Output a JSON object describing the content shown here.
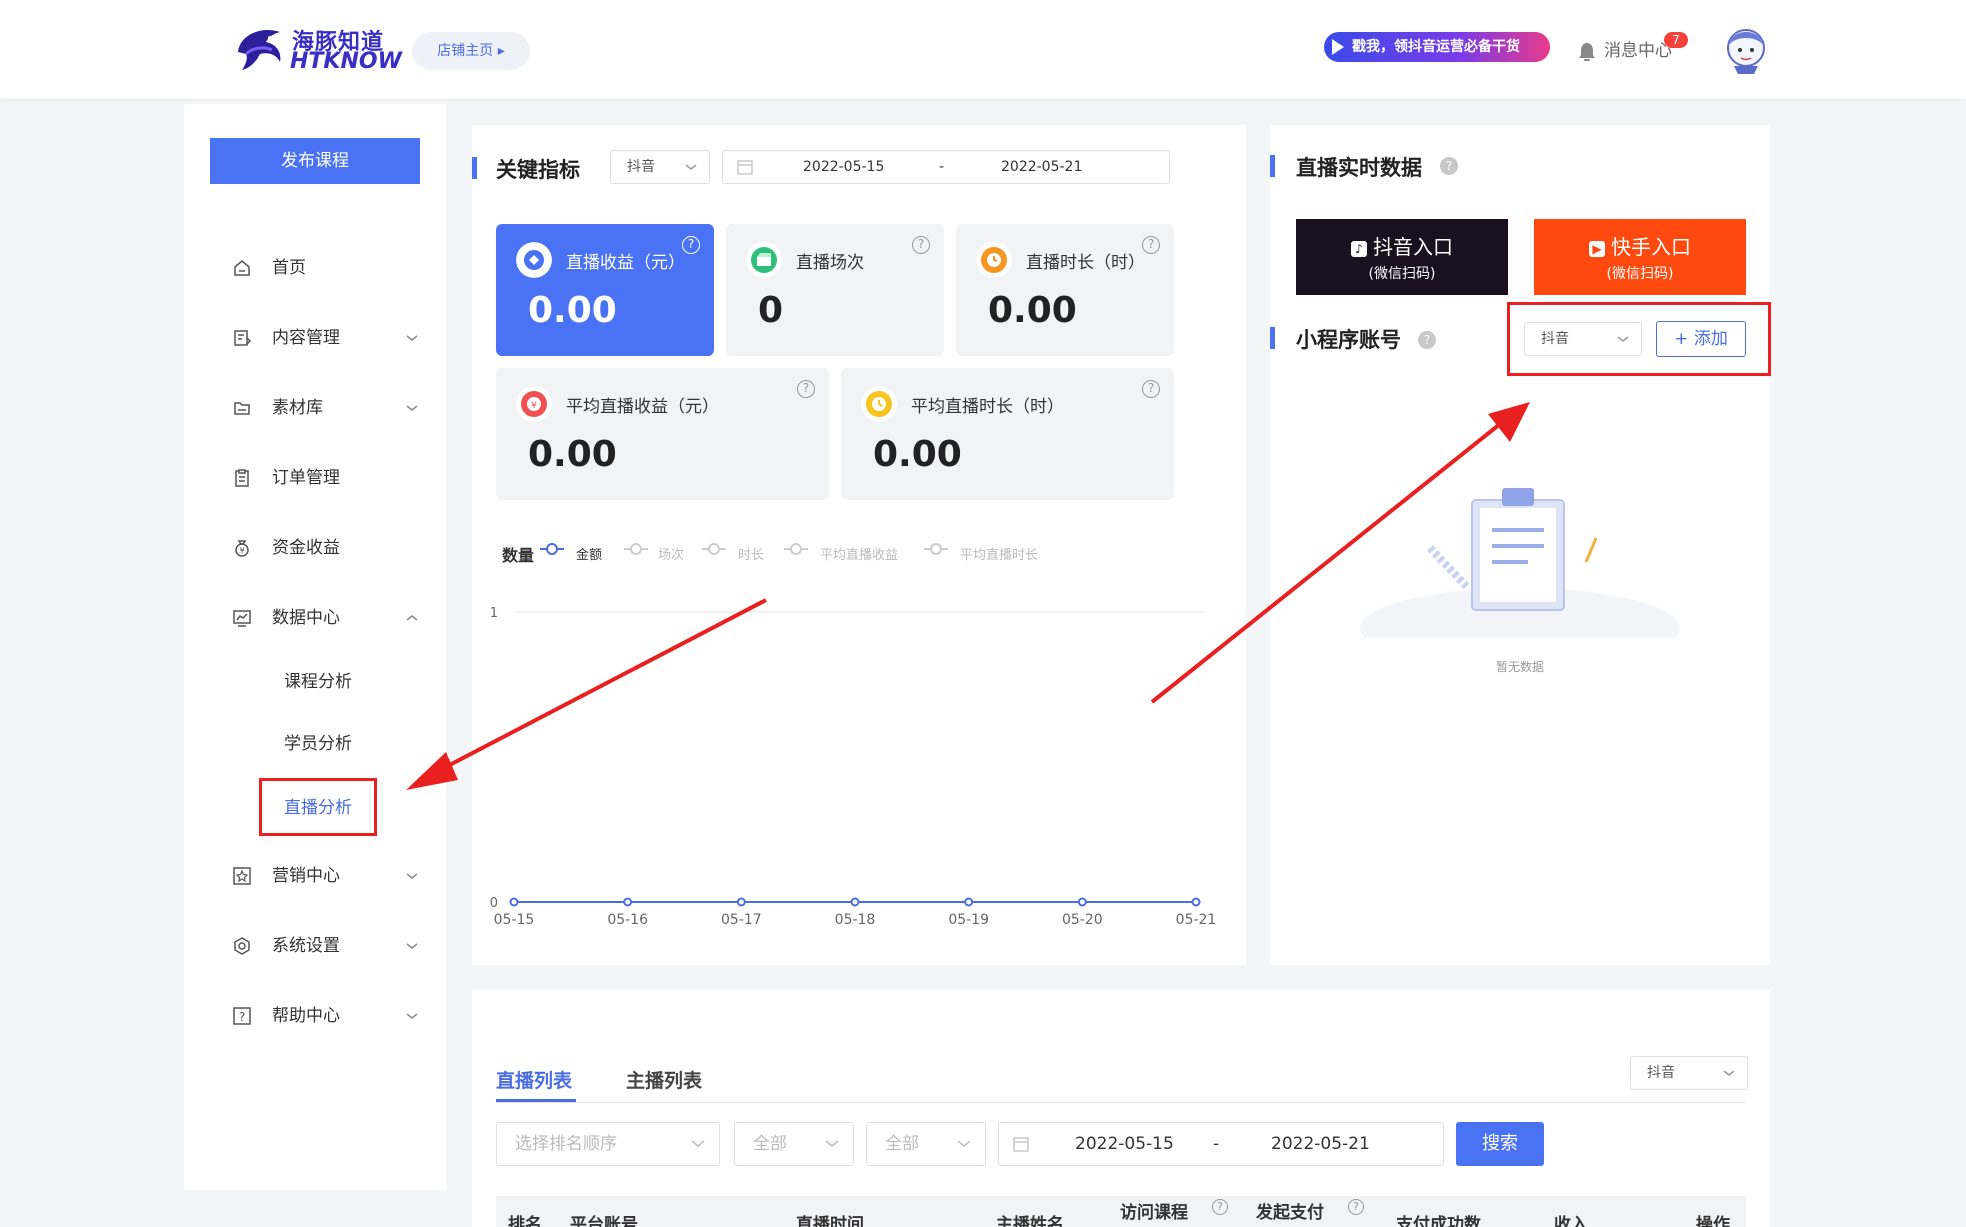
{
  "header": {
    "logo_cn": "海豚知道",
    "logo_en": "HTKNOW",
    "store_button": "店铺主页",
    "promo_text": "戳我，领抖音运营必备干货",
    "message_center": "消息中心",
    "message_count": "7"
  },
  "sidebar": {
    "publish_button": "发布课程",
    "items": [
      {
        "label": "首页",
        "icon": "home-icon"
      },
      {
        "label": "内容管理",
        "icon": "content-icon"
      },
      {
        "label": "素材库",
        "icon": "folder-icon"
      },
      {
        "label": "订单管理",
        "icon": "order-icon"
      },
      {
        "label": "资金收益",
        "icon": "money-bag-icon"
      },
      {
        "label": "数据中心",
        "icon": "chart-icon"
      },
      {
        "label": "营销中心",
        "icon": "star-icon"
      },
      {
        "label": "系统设置",
        "icon": "settings-icon"
      },
      {
        "label": "帮助中心",
        "icon": "help-icon"
      }
    ],
    "sub_items": [
      "课程分析",
      "学员分析",
      "直播分析"
    ],
    "active_sub": "直播分析"
  },
  "metrics": {
    "title": "关键指标",
    "platform": "抖音",
    "date_start": "2022-05-15",
    "date_sep": "-",
    "date_end": "2022-05-21",
    "cards": [
      {
        "label": "直播收益（元）",
        "value": "0.00"
      },
      {
        "label": "直播场次",
        "value": "0"
      },
      {
        "label": "直播时长（时）",
        "value": "0.00"
      },
      {
        "label": "平均直播收益（元）",
        "value": "0.00"
      },
      {
        "label": "平均直播时长（时）",
        "value": "0.00"
      }
    ],
    "legend_title": "数量",
    "legend": [
      "金额",
      "场次",
      "时长",
      "平均直播收益",
      "平均直播时长"
    ]
  },
  "chart_data": {
    "type": "line",
    "x": [
      "05-15",
      "05-16",
      "05-17",
      "05-18",
      "05-19",
      "05-20",
      "05-21"
    ],
    "series": [
      {
        "name": "金额",
        "values": [
          0,
          0,
          0,
          0,
          0,
          0,
          0
        ]
      }
    ],
    "ylim": [
      0,
      1
    ],
    "yticks": [
      "0",
      "1"
    ],
    "grid": true,
    "color": "#4a6ee0"
  },
  "live": {
    "title": "直播实时数据",
    "douyin_entry": "抖音入口",
    "douyin_sub": "(微信扫码)",
    "kuaishou_entry": "快手入口",
    "kuaishou_sub": "(微信扫码)",
    "miniapp_title": "小程序账号",
    "miniapp_platform": "抖音",
    "add_button": "添加",
    "empty_text": "暂无数据"
  },
  "list": {
    "tabs": [
      "直播列表",
      "主播列表"
    ],
    "platform": "抖音",
    "sort_placeholder": "选择排名顺序",
    "filter1": "全部",
    "filter2": "全部",
    "date_start": "2022-05-15",
    "date_sep": "-",
    "date_end": "2022-05-21",
    "search_button": "搜索",
    "columns": [
      "排名",
      "平台账号",
      "直播时间",
      "主播姓名",
      "访问课程",
      "发起支付",
      "支付成功数",
      "收入",
      "操作"
    ]
  },
  "colors": {
    "accent": "#4a72f5",
    "douyin": "#1a1020",
    "kuaishou": "#fe4a0f",
    "annotation": "#e8201f"
  }
}
